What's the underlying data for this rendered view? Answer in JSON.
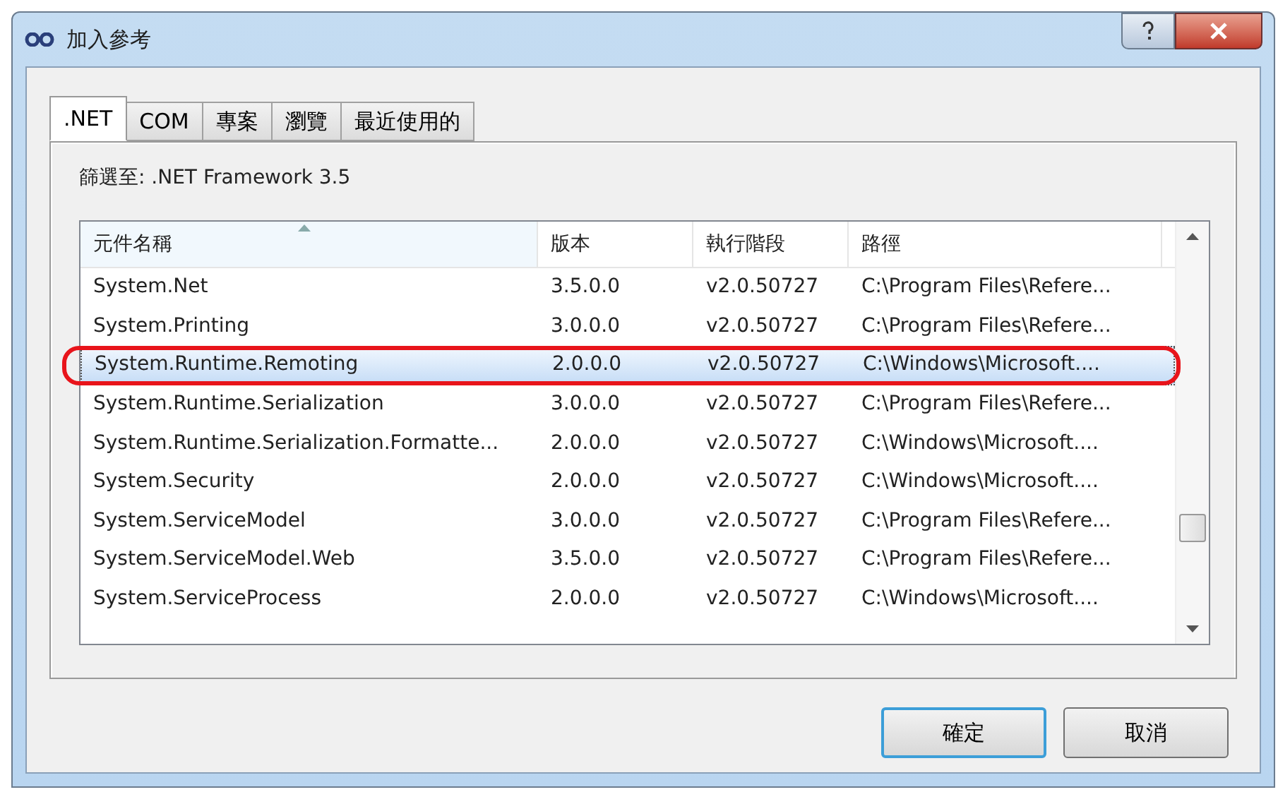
{
  "window": {
    "title": "加入參考"
  },
  "tabs": [
    {
      "label": ".NET",
      "selected": true
    },
    {
      "label": "COM",
      "selected": false
    },
    {
      "label": "專案",
      "selected": false
    },
    {
      "label": "瀏覽",
      "selected": false
    },
    {
      "label": "最近使用的",
      "selected": false
    }
  ],
  "filter_label": "篩選至: .NET Framework 3.5",
  "table": {
    "columns": [
      {
        "label": "元件名稱",
        "sorted": true
      },
      {
        "label": "版本",
        "sorted": false
      },
      {
        "label": "執行階段",
        "sorted": false
      },
      {
        "label": "路徑",
        "sorted": false
      }
    ],
    "rows": [
      {
        "cells": [
          "System.Net",
          "3.5.0.0",
          "v2.0.50727",
          "C:\\Program Files\\Refere..."
        ],
        "selected": false,
        "circled": false
      },
      {
        "cells": [
          "System.Printing",
          "3.0.0.0",
          "v2.0.50727",
          "C:\\Program Files\\Refere..."
        ],
        "selected": false,
        "circled": false
      },
      {
        "cells": [
          "System.Runtime.Remoting",
          "2.0.0.0",
          "v2.0.50727",
          "C:\\Windows\\Microsoft...."
        ],
        "selected": true,
        "circled": true
      },
      {
        "cells": [
          "System.Runtime.Serialization",
          "3.0.0.0",
          "v2.0.50727",
          "C:\\Program Files\\Refere..."
        ],
        "selected": false,
        "circled": false
      },
      {
        "cells": [
          "System.Runtime.Serialization.Formatte...",
          "2.0.0.0",
          "v2.0.50727",
          "C:\\Windows\\Microsoft...."
        ],
        "selected": false,
        "circled": false
      },
      {
        "cells": [
          "System.Security",
          "2.0.0.0",
          "v2.0.50727",
          "C:\\Windows\\Microsoft...."
        ],
        "selected": false,
        "circled": false
      },
      {
        "cells": [
          "System.ServiceModel",
          "3.0.0.0",
          "v2.0.50727",
          "C:\\Program Files\\Refere..."
        ],
        "selected": false,
        "circled": false
      },
      {
        "cells": [
          "System.ServiceModel.Web",
          "3.5.0.0",
          "v2.0.50727",
          "C:\\Program Files\\Refere..."
        ],
        "selected": false,
        "circled": false
      },
      {
        "cells": [
          "System.ServiceProcess",
          "2.0.0.0",
          "v2.0.50727",
          "C:\\Windows\\Microsoft...."
        ],
        "selected": false,
        "circled": false
      }
    ]
  },
  "buttons": [
    {
      "label": "確定",
      "default": true
    },
    {
      "label": "取消",
      "default": false
    }
  ]
}
